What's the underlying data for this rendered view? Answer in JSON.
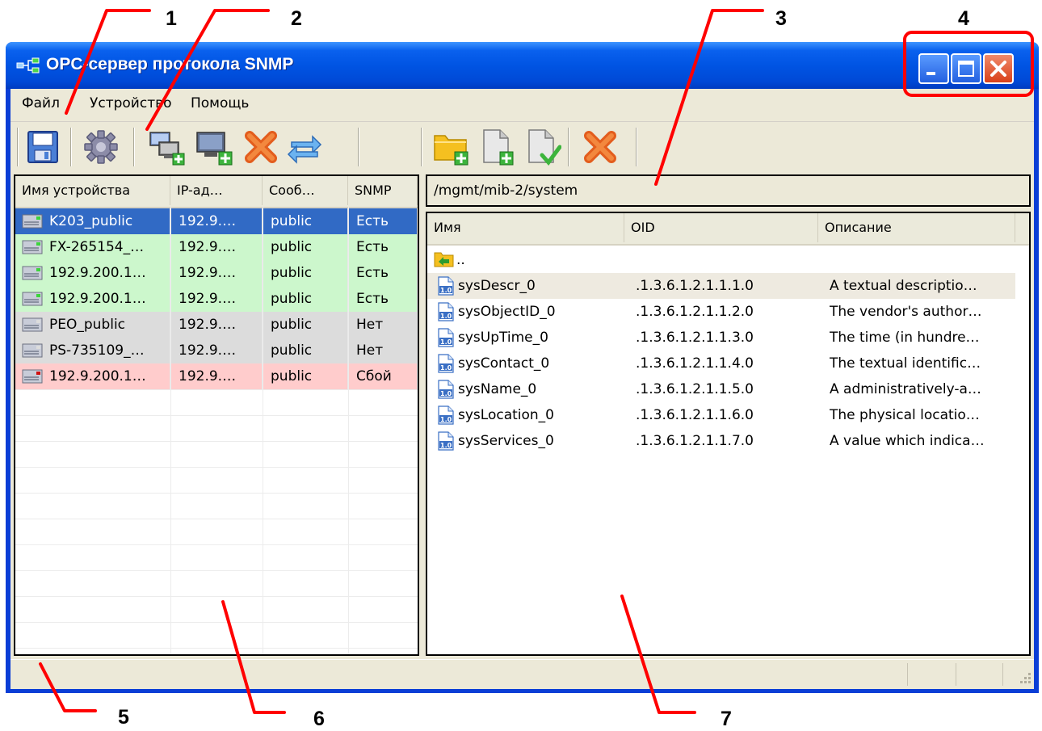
{
  "window": {
    "title": "OPC-сервер протокола SNMP",
    "controls": [
      "minimize",
      "maximize",
      "close"
    ]
  },
  "callouts": [
    "1",
    "2",
    "3",
    "4",
    "5",
    "6",
    "7"
  ],
  "menu": {
    "items": [
      {
        "label": "Файл"
      },
      {
        "label": "Устройство"
      },
      {
        "label": "Помощь"
      }
    ]
  },
  "toolbar": {
    "left_icons": [
      "save-icon",
      "settings-gear-icon",
      "add-device-group-icon",
      "add-device-icon",
      "delete-device-icon",
      "refresh-icon"
    ],
    "right_icons": [
      "add-folder-icon",
      "add-item-icon",
      "confirm-item-icon",
      "delete-item-icon"
    ]
  },
  "devices": {
    "columns": [
      "Имя устройства",
      "IP-ад…",
      "Сооб…",
      "SNMP"
    ],
    "rows": [
      {
        "name": "K203_public",
        "ip": "192.9.…",
        "community": "public",
        "snmp": "Есть",
        "state": "selected"
      },
      {
        "name": "FX-265154_…",
        "ip": "192.9.…",
        "community": "public",
        "snmp": "Есть",
        "state": "ok"
      },
      {
        "name": "192.9.200.1…",
        "ip": "192.9.…",
        "community": "public",
        "snmp": "Есть",
        "state": "ok"
      },
      {
        "name": "192.9.200.1…",
        "ip": "192.9.…",
        "community": "public",
        "snmp": "Есть",
        "state": "ok"
      },
      {
        "name": "PEO_public",
        "ip": "192.9.…",
        "community": "public",
        "snmp": "Нет",
        "state": "none"
      },
      {
        "name": "PS-735109_…",
        "ip": "192.9.…",
        "community": "public",
        "snmp": "Нет",
        "state": "none"
      },
      {
        "name": "192.9.200.1…",
        "ip": "192.9.…",
        "community": "public",
        "snmp": "Сбой",
        "state": "fail"
      }
    ]
  },
  "path": {
    "value": "/mgmt/mib-2/system"
  },
  "oids": {
    "columns": [
      "Имя",
      "OID",
      "Описание"
    ],
    "up_label": "..",
    "rows": [
      {
        "name": "sysDescr_0",
        "oid": ".1.3.6.1.2.1.1.1.0",
        "desc": "A textual descriptio…",
        "hover": true
      },
      {
        "name": "sysObjectID_0",
        "oid": ".1.3.6.1.2.1.1.2.0",
        "desc": "The vendor's author…",
        "hover": false
      },
      {
        "name": "sysUpTime_0",
        "oid": ".1.3.6.1.2.1.1.3.0",
        "desc": "The time (in hundre…",
        "hover": false
      },
      {
        "name": "sysContact_0",
        "oid": ".1.3.6.1.2.1.1.4.0",
        "desc": "The textual identific…",
        "hover": false
      },
      {
        "name": "sysName_0",
        "oid": ".1.3.6.1.2.1.1.5.0",
        "desc": "A administratively-a…",
        "hover": false
      },
      {
        "name": "sysLocation_0",
        "oid": ".1.3.6.1.2.1.1.6.0",
        "desc": "The physical locatio…",
        "hover": false
      },
      {
        "name": "sysServices_0",
        "oid": ".1.3.6.1.2.1.1.7.0",
        "desc": "A value which indica…",
        "hover": false
      }
    ]
  },
  "colors": {
    "selected_row": "#316ac5",
    "ok_row": "#ccf7cc",
    "none_row": "#dcdcdc",
    "fail_row": "#ffcccc",
    "hover_row": "#eeeae0",
    "callout_lines": "#ff0000"
  }
}
